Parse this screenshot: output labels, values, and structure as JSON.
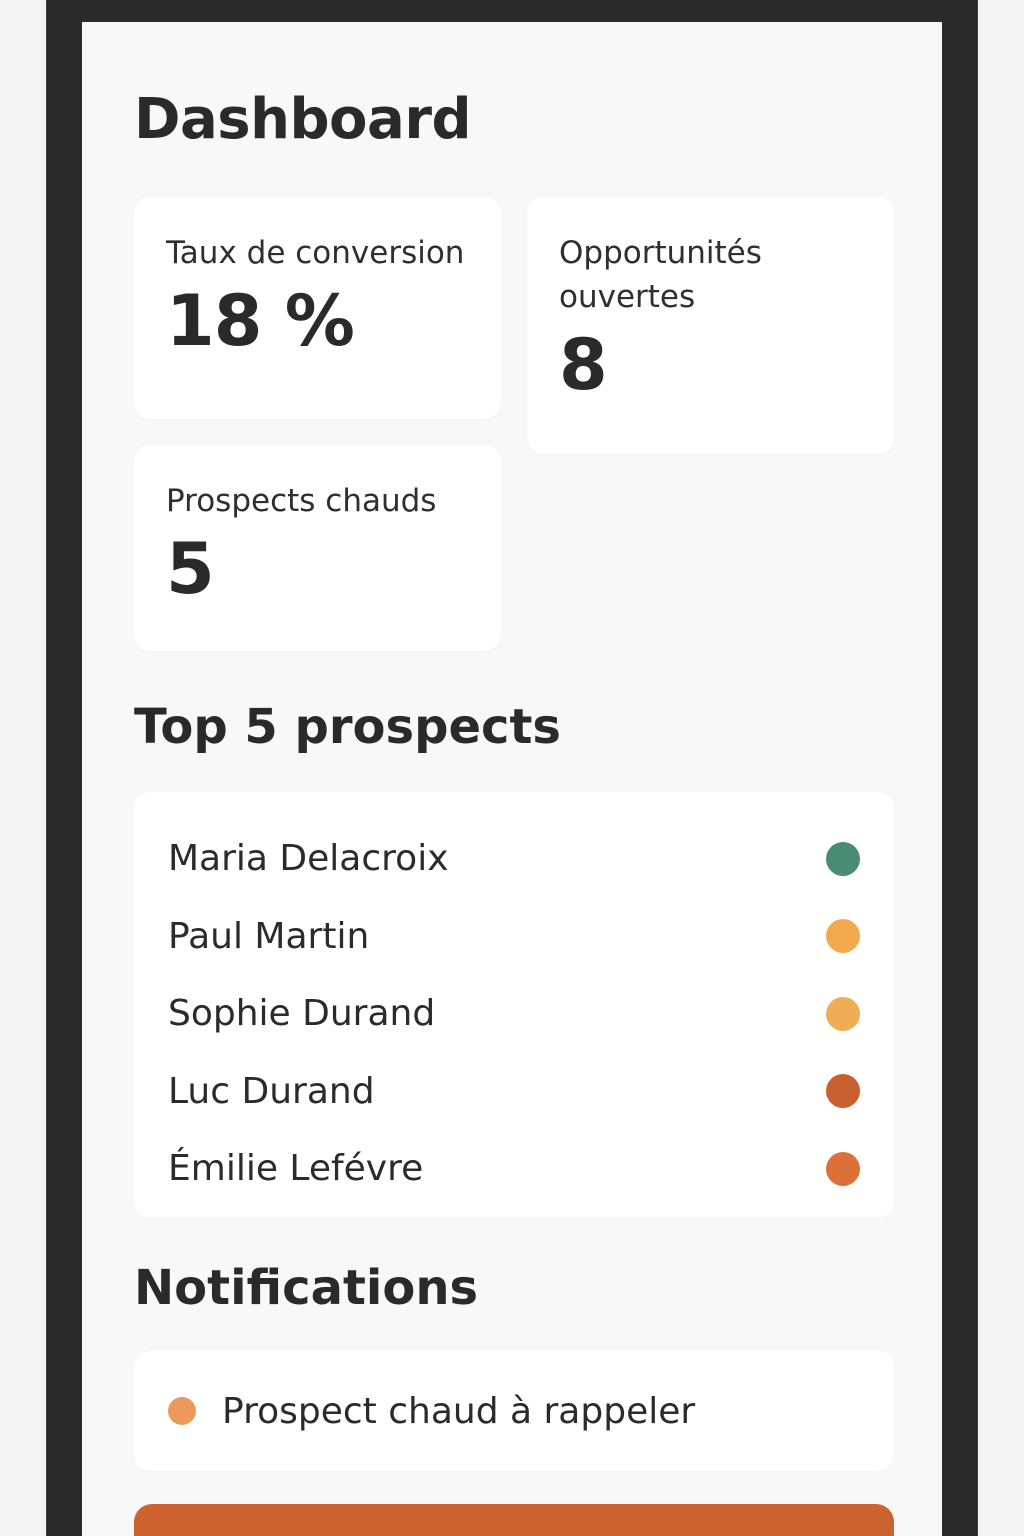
{
  "page": {
    "title": "Dashboard"
  },
  "kpis": [
    {
      "label": "Taux de conversion",
      "value": "18 %"
    },
    {
      "label": "Opportunités ouvertes",
      "value": "8"
    },
    {
      "label": "Prospects chauds",
      "value": "5"
    }
  ],
  "top_prospects": {
    "title": "Top 5 prospects",
    "items": [
      {
        "name": "Maria Delacroix",
        "status_color": "#4a8c73"
      },
      {
        "name": "Paul Martin",
        "status_color": "#f2a84c"
      },
      {
        "name": "Sophie Durand",
        "status_color": "#f0ad56"
      },
      {
        "name": "Luc Durand",
        "status_color": "#c9602f"
      },
      {
        "name": "Émilie Lefévre",
        "status_color": "#dc7038"
      }
    ]
  },
  "notifications": {
    "title": "Notifications",
    "items": [
      {
        "text": "Prospect chaud à rappeler",
        "color": "#eb9a5e"
      }
    ]
  },
  "cta": {
    "color": "#cc6230"
  },
  "colors": {
    "frame": "#2a2a2a",
    "screen_background": "#f8f8f8",
    "card_background": "#ffffff",
    "accent": "#cc6230"
  }
}
